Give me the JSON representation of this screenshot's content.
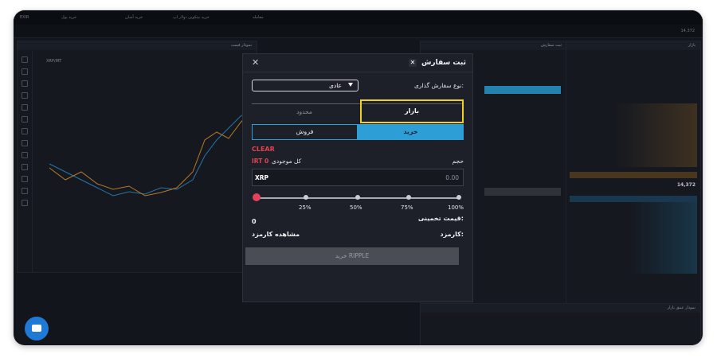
{
  "background_app": {
    "menu": [
      "خرید بیتکوین دولار اپ",
      "خرید آسان",
      "خرید پول",
      "معامله"
    ],
    "chart_panel_title": "نمودار قیمت",
    "market_panel_title": "ثبت سفارش",
    "orderbook_panel_title": "بازار",
    "orderbook_mid_price": "14,372",
    "depth_panel_title": "نمودار عمق بازار",
    "pair_label": "XRP/IRT"
  },
  "modal": {
    "title": "ثبت سفارش",
    "close_icon": "close-icon",
    "order_type_label": "نوع سفارش گذاری:",
    "order_type_value": "عادی",
    "tabs": {
      "market": "بازار",
      "limit": "محدود"
    },
    "sides": {
      "buy": "خرید",
      "sell": "فروش"
    },
    "clear": "CLEAR",
    "balance_label": "کل موجودی",
    "balance_value": "IRT 0",
    "volume_label": "حجم",
    "volume_unit": "XRP",
    "volume_value": "0.00",
    "slider": {
      "value_percent": 0,
      "ticks": [
        "25%",
        "50%",
        "75%",
        "100%"
      ]
    },
    "estimated_price_label": "قیمت تخمینی:",
    "estimated_price_value": "0",
    "fee_label": "کارمزد:",
    "fee_link": "مشاهده کارمزد",
    "submit_label": "خرید RIPPLE"
  },
  "colors": {
    "accent_blue": "#2d9fd6",
    "highlight_yellow": "#f2d01f",
    "danger_red": "#e0434f"
  }
}
